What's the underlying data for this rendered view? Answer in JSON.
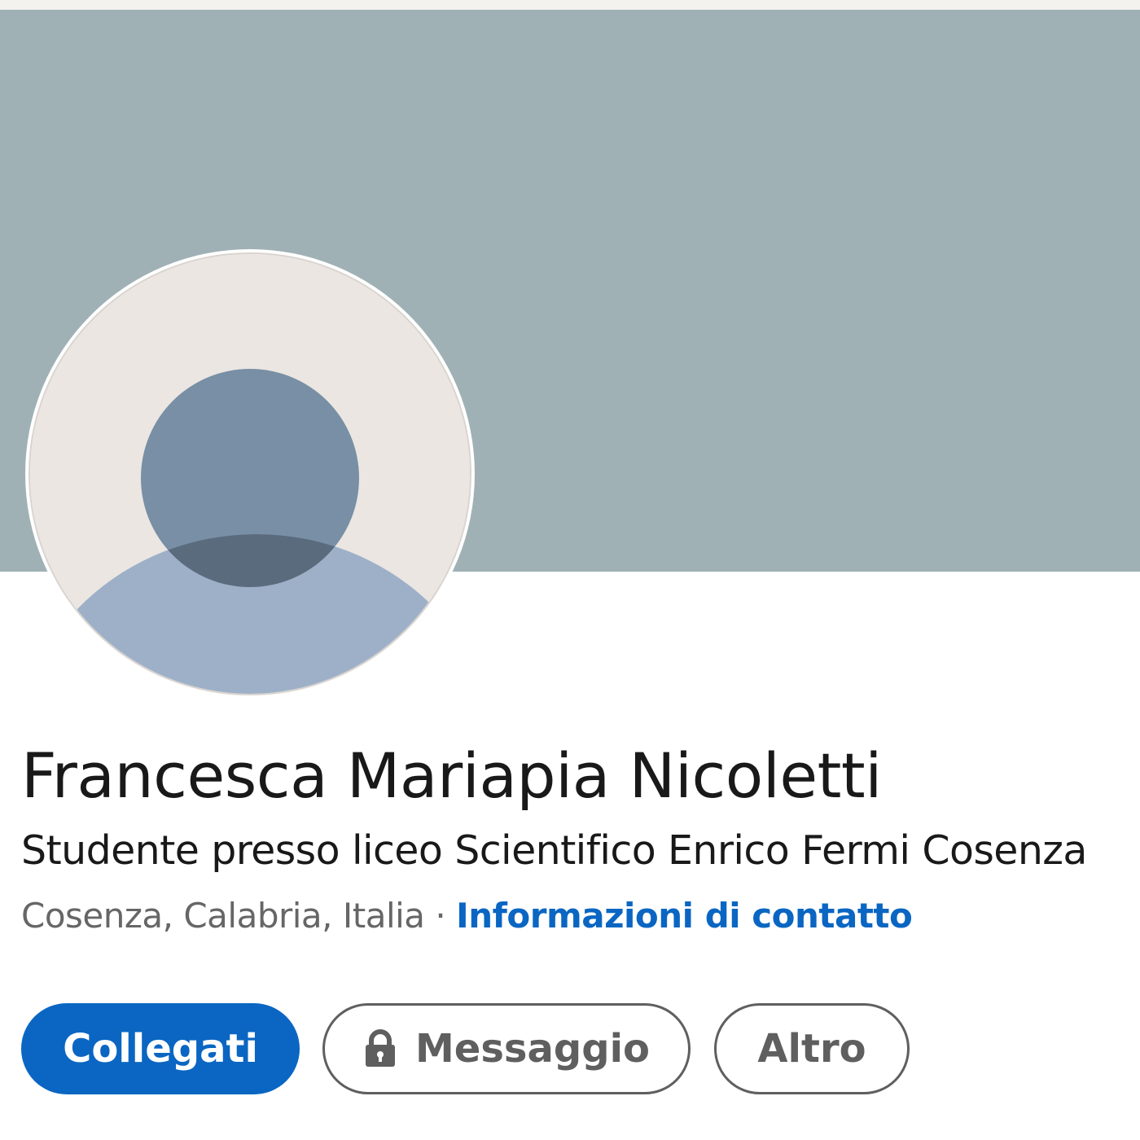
{
  "profile": {
    "name": "Francesca Mariapia Nicoletti",
    "headline": "Studente presso liceo Scientifico Enrico Fermi Cosenza",
    "location": "Cosenza, Calabria, Italia",
    "separator": "·",
    "contact_link": "Informazioni di contatto"
  },
  "actions": {
    "connect_label": "Collegati",
    "message_label": "Messaggio",
    "more_label": "Altro"
  },
  "icons": {
    "avatar": "default-avatar-icon",
    "lock": "lock-icon"
  },
  "colors": {
    "banner": "#a0b1b5",
    "avatar_bg": "#ebe6e2",
    "avatar_head": "#788fa5",
    "avatar_body": "#9db0c8",
    "accent": "#0a66c2",
    "text_primary": "#191919",
    "text_secondary": "#666666"
  }
}
